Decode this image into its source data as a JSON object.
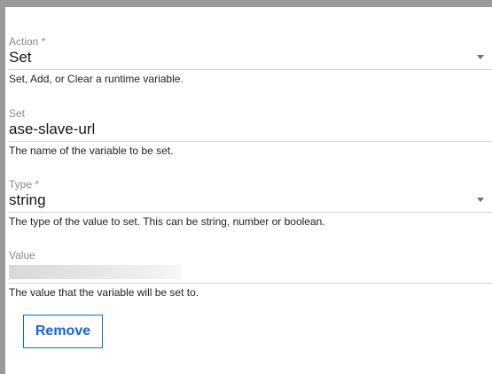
{
  "form": {
    "action": {
      "label": "Action *",
      "value": "Set",
      "helper": "Set, Add, or Clear a runtime variable."
    },
    "set": {
      "label": "Set",
      "value": "ase-slave-url",
      "helper": "The name of the variable to be set."
    },
    "type": {
      "label": "Type *",
      "value": "string",
      "helper": "The type of the value to set. This can be string, number or boolean."
    },
    "value": {
      "label": "Value",
      "value": "",
      "helper": "The value that the variable will be set to."
    },
    "remove_label": "Remove"
  },
  "icons": {
    "dropdown": "chevron-down-icon"
  },
  "colors": {
    "accent": "#0f62fe",
    "label": "#8a8a8a",
    "text": "#161616",
    "border": "#d4d4d4"
  }
}
